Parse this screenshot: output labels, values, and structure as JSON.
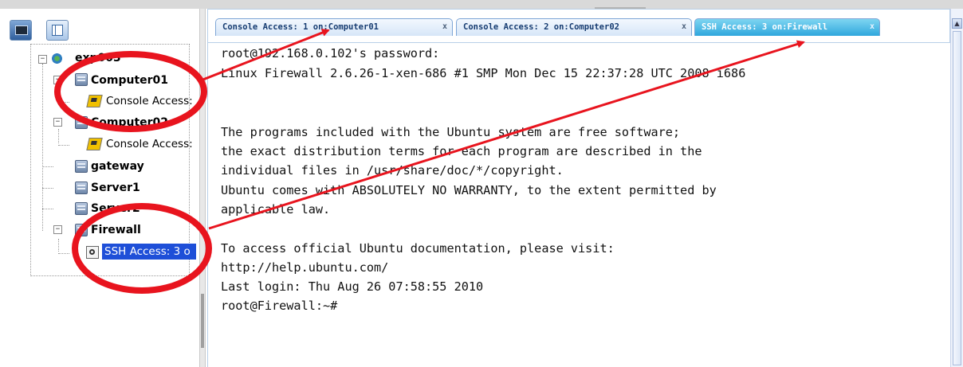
{
  "tabs": [
    {
      "label": "Console Access: 1 on:Computer01",
      "active": false
    },
    {
      "label": "Console Access: 2 on:Computer02",
      "active": false
    },
    {
      "label": "SSH Access: 3 on:Firewall",
      "active": true
    }
  ],
  "tab_close_glyph": "x",
  "tree": {
    "root": "exp003",
    "computer01": "Computer01",
    "computer01_access": "Console Access:",
    "computer02": "Computer02",
    "computer02_access": "Console Access:",
    "gateway": "gateway",
    "server1": "Server1",
    "server2": "Server2",
    "firewall": "Firewall",
    "firewall_access": "SSH Access: 3 o"
  },
  "console": {
    "lines": [
      "root@192.168.0.102's password:",
      "Linux Firewall 2.6.26-1-xen-686 #1 SMP Mon Dec 15 22:37:28 UTC 2008 i686",
      "",
      "The programs included with the Ubuntu system are free software;",
      "the exact distribution terms for each program are described in the",
      "individual files in /usr/share/doc/*/copyright.",
      "",
      "Ubuntu comes with ABSOLUTELY NO WARRANTY, to the extent permitted by",
      "applicable law.",
      "",
      "To access official Ubuntu documentation, please visit:",
      "http://help.ubuntu.com/",
      "Last login: Thu Aug 26 07:58:55 2010",
      "root@Firewall:~#"
    ]
  },
  "icons": {
    "console_toolbar": "console-icon",
    "layout_toolbar": "layout-icon",
    "server": "server-icon",
    "network": "network-icon",
    "console_access": "console-access-icon",
    "ssh_access": "ssh-access-icon"
  },
  "colors": {
    "highlight_red": "#e8141e",
    "selection_blue": "#1e4fd8",
    "active_tab": "#2fa7dd",
    "tab_text": "#163c71"
  },
  "expand_glyph": "−"
}
